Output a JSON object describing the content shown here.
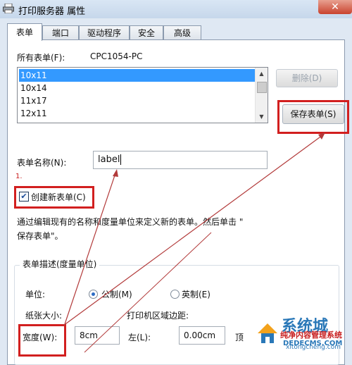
{
  "window": {
    "title": "打印服务器 属性",
    "close_glyph": "✕"
  },
  "tabs": [
    {
      "label": "表单",
      "active": true
    },
    {
      "label": "端口"
    },
    {
      "label": "驱动程序"
    },
    {
      "label": "安全"
    },
    {
      "label": "高级"
    }
  ],
  "forms": {
    "all_forms_label": "所有表单(F):",
    "server_name": "CPC1054-PC",
    "list": [
      "10x11",
      "10x14",
      "11x17",
      "12x11"
    ],
    "selected": "10x11",
    "delete_label": "删除(D)",
    "save_label": "保存表单(S)",
    "form_name_label": "表单名称(N):",
    "form_name_value": "label",
    "step_number": "1.",
    "create_new_label": "创建新表单(C)",
    "create_new_checked": true,
    "help_text_line1": "通过编辑现有的名称和度量单位来定义新的表单。然后单击 \"",
    "help_text_line2": "保存表单\"。"
  },
  "description": {
    "title": "表单描述(度量单位)",
    "unit_label": "单位:",
    "metric_label": "公制(M)",
    "imperial_label": "英制(E)",
    "selected_unit": "metric",
    "paper_size_label": "纸张大小:",
    "margins_label": "打印机区域边距:",
    "width_label": "宽度(W):",
    "width_value": "8cm",
    "left_label": "左(L):",
    "left_value": "0.00cm",
    "top_label": "顶"
  },
  "watermark": {
    "brand": "系统城",
    "subtitle": "纯净内容管理系统",
    "url": "DEDECMS.COM",
    "url2": "xitongcheng.com"
  },
  "colors": {
    "highlight_red": "#d21f1f",
    "selection_blue": "#3399ff"
  }
}
